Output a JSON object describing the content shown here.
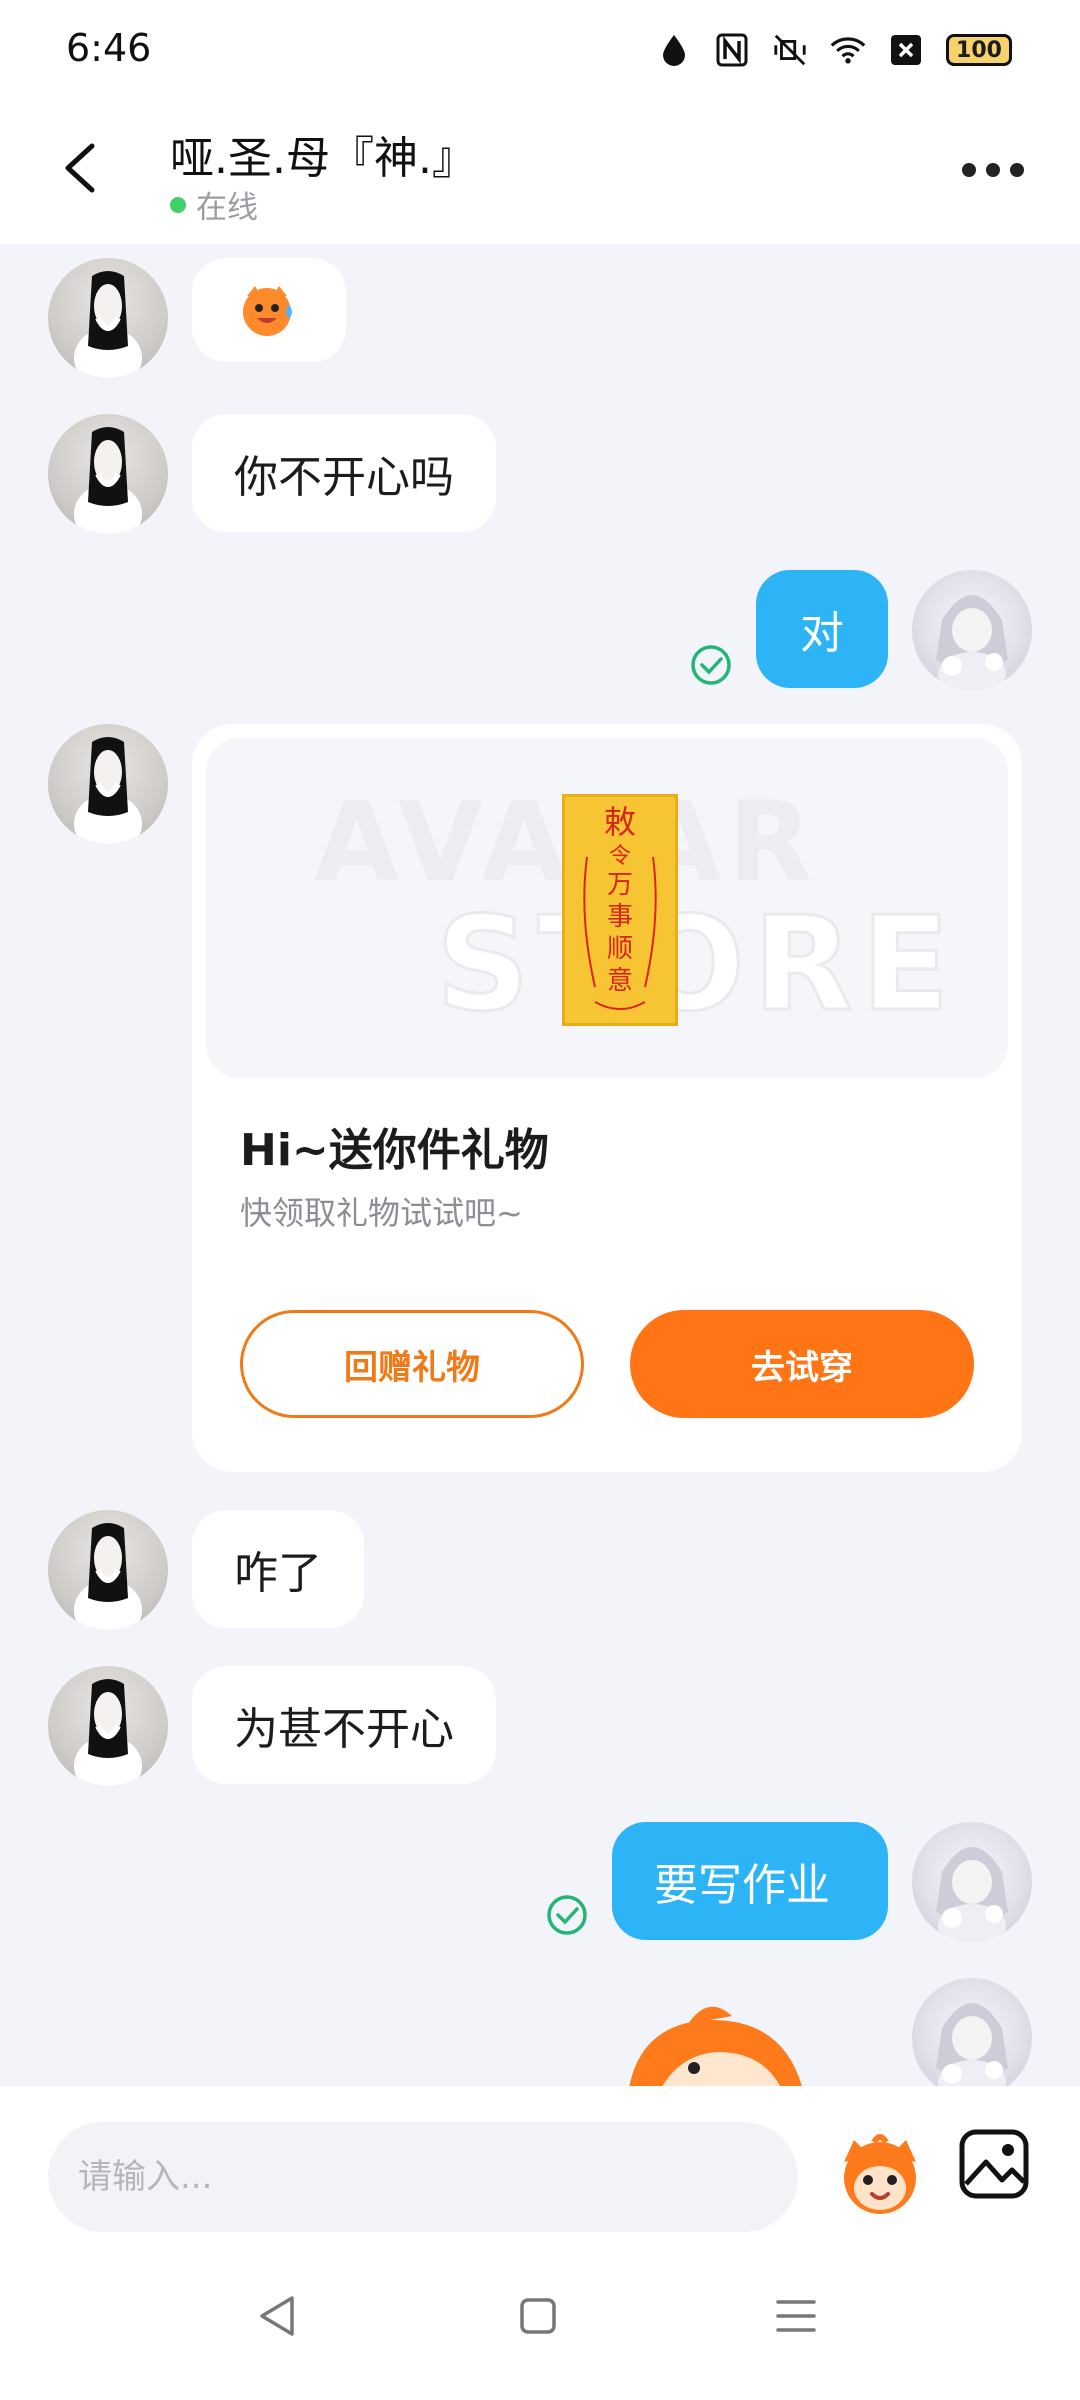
{
  "status_bar": {
    "time": "6:46",
    "battery": "100",
    "icons": [
      "drop-icon",
      "nfc-icon",
      "mute-vibrate-icon",
      "wifi-icon",
      "sim-off-icon",
      "battery-icon"
    ]
  },
  "header": {
    "title": "哑.圣.母『神.』",
    "status": "在线",
    "status_color": "#3dd168"
  },
  "messages": [
    {
      "from": "peer",
      "type": "sticker",
      "sticker": "crying-laughing-mascot-sticker"
    },
    {
      "from": "peer",
      "text": "你不开心吗"
    },
    {
      "from": "me",
      "text": "对"
    },
    {
      "from": "peer",
      "text": "咋了"
    },
    {
      "from": "peer",
      "text": "为甚不开心"
    },
    {
      "from": "me",
      "text": "要写作业"
    },
    {
      "from": "me",
      "type": "sticker",
      "sticker": "orange-mascot-sticker"
    }
  ],
  "gift_card": {
    "title": "Hi~送你件礼物",
    "subtitle": "快领取礼物试试吧~",
    "return_gift_label": "回赠礼物",
    "try_on_label": "去试穿",
    "watermark_line1": "AVATAR",
    "watermark_line2": "STORE",
    "item_text": "敕令万事顺意"
  },
  "composer": {
    "placeholder": "请输入..."
  },
  "colors": {
    "accent_orange": "#ff7414",
    "outgoing_bubble": "#2db4f6",
    "background": "#f2f4f9"
  }
}
